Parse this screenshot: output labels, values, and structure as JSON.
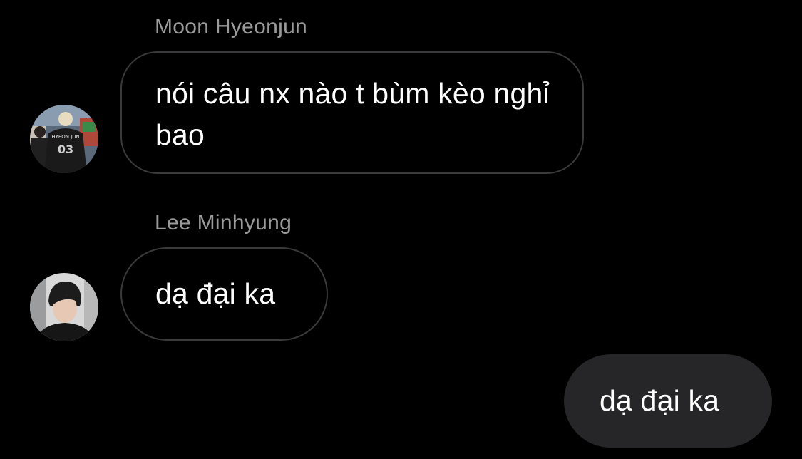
{
  "thread": {
    "messages": [
      {
        "sender": "Moon Hyeonjun",
        "text": "nói câu nx nào t bùm kèo nghỉ bao",
        "direction": "incoming",
        "jersey_name": "HYEON JUN",
        "jersey_number": "03"
      },
      {
        "sender": "Lee Minhyung",
        "text": "dạ đại ka",
        "direction": "incoming"
      },
      {
        "text": "dạ đại ka",
        "direction": "outgoing"
      }
    ]
  },
  "colors": {
    "background": "#000000",
    "incoming_border": "#3a3a3c",
    "outgoing_bubble": "#262628",
    "sender_name": "#9a9a9a",
    "text": "#ffffff"
  }
}
